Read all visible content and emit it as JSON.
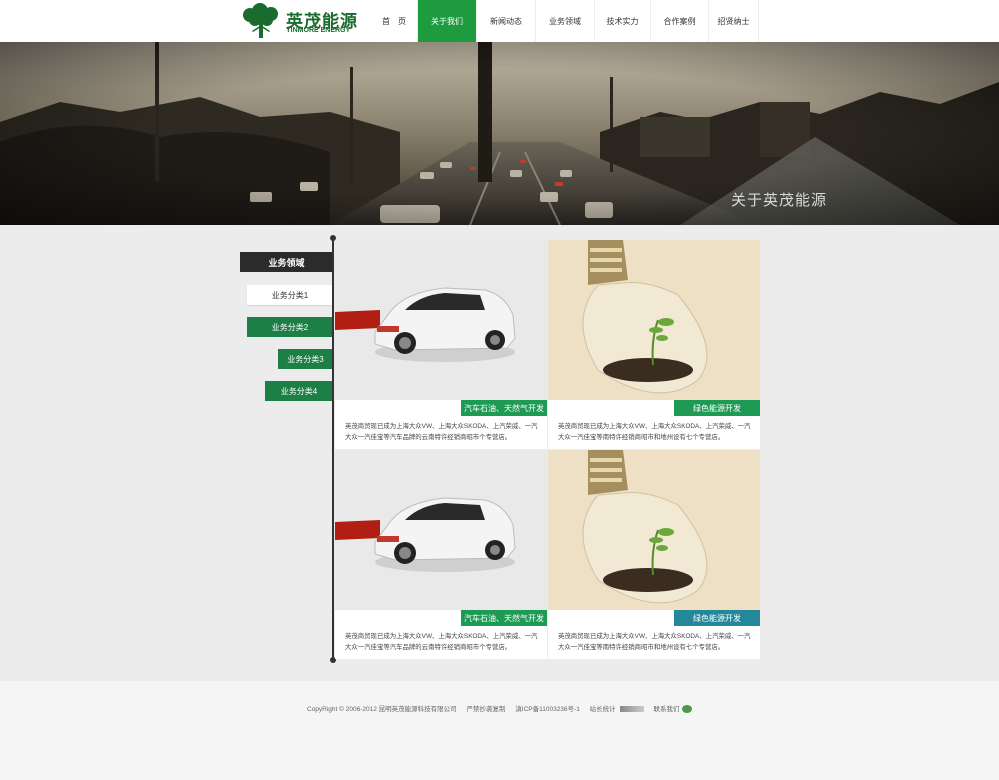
{
  "brand": {
    "name_cn": "英茂能源",
    "name_en": "YINMORE ENERGY"
  },
  "nav": {
    "items": [
      {
        "label": "首　页",
        "active": false
      },
      {
        "label": "关于我们",
        "active": true
      },
      {
        "label": "新闻动态",
        "active": false
      },
      {
        "label": "业务领域",
        "active": false
      },
      {
        "label": "技术实力",
        "active": false
      },
      {
        "label": "合作案例",
        "active": false
      },
      {
        "label": "招贤纳士",
        "active": false
      }
    ]
  },
  "banner": {
    "title": "关于英茂能源"
  },
  "sidebar": {
    "title": "业务领域",
    "items": [
      {
        "label": "业务分类1",
        "style": "white"
      },
      {
        "label": "业务分类2",
        "style": "green"
      },
      {
        "label": "业务分类3",
        "style": "green"
      },
      {
        "label": "业务分类4",
        "style": "green"
      }
    ]
  },
  "cards": [
    {
      "image": "car",
      "tag": "汽车石油、天然气开发",
      "tag_color": "green",
      "desc": "英茂商贸现已成为上海大众VW、上海大众SKODA、上汽荣威、一汽大众一汽佳宝等汽车品牌的云南特许经销商昭市个专营店。"
    },
    {
      "image": "bulb",
      "tag": "绿色能源开发",
      "tag_color": "green",
      "desc": "英茂商贸现已成为上海大众VW、上海大众SKODA、上汽荣威、一汽大众一汽佳宝等南特许经销商昭市和地州设有七个专营店。"
    },
    {
      "image": "car",
      "tag": "汽车石油、天然气开发",
      "tag_color": "green",
      "desc": "英茂商贸现已成为上海大众VW、上海大众SKODA、上汽荣威、一汽大众一汽佳宝等汽车品牌的云南特许经销商昭市个专营店。"
    },
    {
      "image": "bulb",
      "tag": "绿色能源开发",
      "tag_color": "teal",
      "desc": "英茂商贸现已成为上海大众VW、上海大众SKODA、上汽荣威、一汽大众一汽佳宝等南特许经销商昭市和地州设有七个专营店。"
    }
  ],
  "footer": {
    "copyright": "CopyRight © 2006-2012 昆明英茂能源科技有限公司",
    "rights": "严禁抄袭复制",
    "icp": "滇ICP备11003236号-1",
    "stats": "站长统计",
    "contact": "联系我们"
  },
  "colors": {
    "primary_green": "#1e9a3f",
    "dark_green": "#1c7f45",
    "teal": "#25889a",
    "sidebar_dark": "#2b2b2b"
  }
}
